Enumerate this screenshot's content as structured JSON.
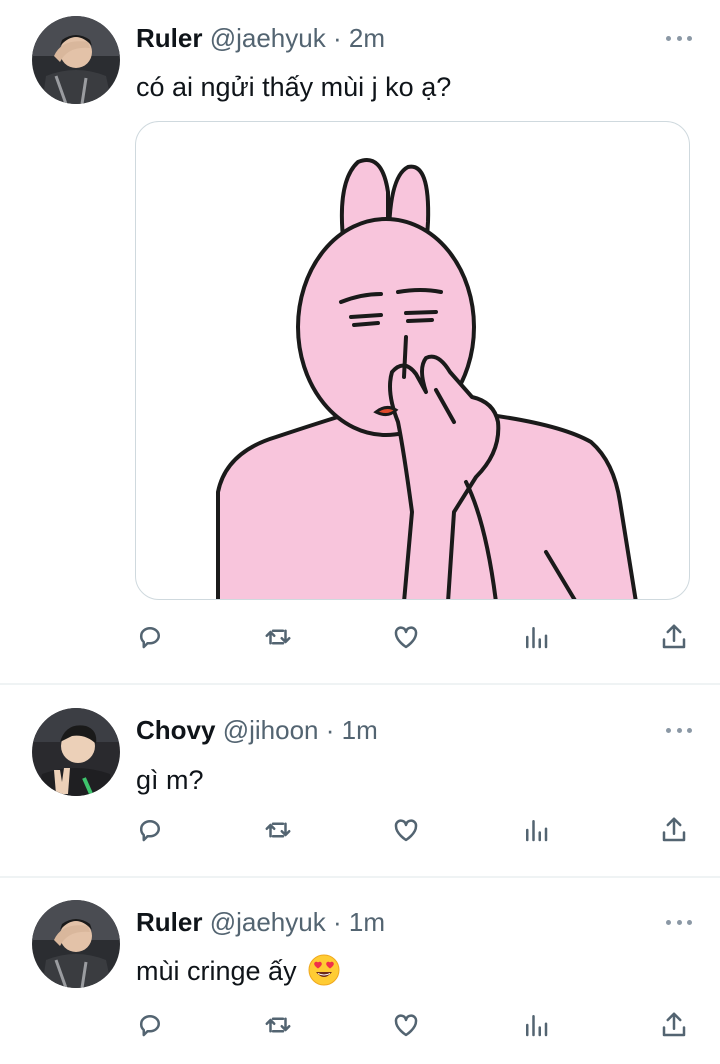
{
  "tweets": [
    {
      "name": "Ruler",
      "handle": "@jaehyuk",
      "sep": "·",
      "time": "2m",
      "text": "có ai ngửi thấy mùi j ko ạ?",
      "avatar_icon": "user-avatar-ruler",
      "media": "pink-bunny-meme-image"
    },
    {
      "name": "Chovy",
      "handle": "@jihoon",
      "sep": "·",
      "time": "1m",
      "text": "gì m?",
      "avatar_icon": "user-avatar-chovy"
    },
    {
      "name": "Ruler",
      "handle": "@jaehyuk",
      "sep": "·",
      "time": "1m",
      "text": "mùi cringe ấy",
      "emoji": "heart-eyes-emoji",
      "avatar_icon": "user-avatar-ruler"
    }
  ],
  "action_icons": [
    "reply-icon",
    "retweet-icon",
    "like-icon",
    "views-icon",
    "share-icon"
  ],
  "colors": {
    "text": "#0f1419",
    "secondary": "#536471",
    "divider": "#eff3f4",
    "bunny_pink": "#f8c5dc"
  }
}
